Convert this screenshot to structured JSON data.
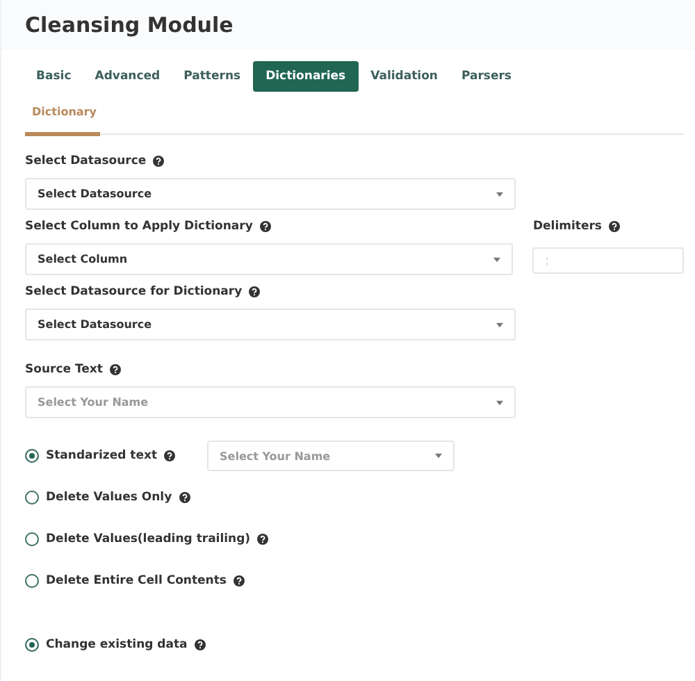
{
  "title": "Cleansing Module",
  "tabs": [
    {
      "label": "Basic",
      "selected": false
    },
    {
      "label": "Advanced",
      "selected": false
    },
    {
      "label": "Patterns",
      "selected": false
    },
    {
      "label": "Dictionaries",
      "selected": true
    },
    {
      "label": "Validation",
      "selected": false
    },
    {
      "label": "Parsers",
      "selected": false
    }
  ],
  "subtabs": [
    {
      "label": "Dictionary",
      "selected": true
    }
  ],
  "fields": [
    {
      "label": "Select Datasource",
      "value": "Select Datasource"
    },
    {
      "label": "Select Column to Apply Dictionary",
      "value": "Select Column",
      "side": {
        "label": "Delimiters",
        "placeholder": ";"
      }
    },
    {
      "label": "Select Datasource for Dictionary",
      "value": "Select Datasource"
    },
    {
      "label": "Source Text",
      "placeholder": "Select Your Name"
    }
  ],
  "options": [
    {
      "label": "Standarized text",
      "selected": true,
      "select": {
        "placeholder": "Select Your Name"
      }
    },
    {
      "label": "Delete Values Only",
      "selected": false
    },
    {
      "label": "Delete Values(leading trailing)",
      "selected": false
    },
    {
      "label": "Delete Entire Cell Contents",
      "selected": false
    }
  ],
  "change_option": {
    "label": "Change existing data",
    "selected": true
  }
}
